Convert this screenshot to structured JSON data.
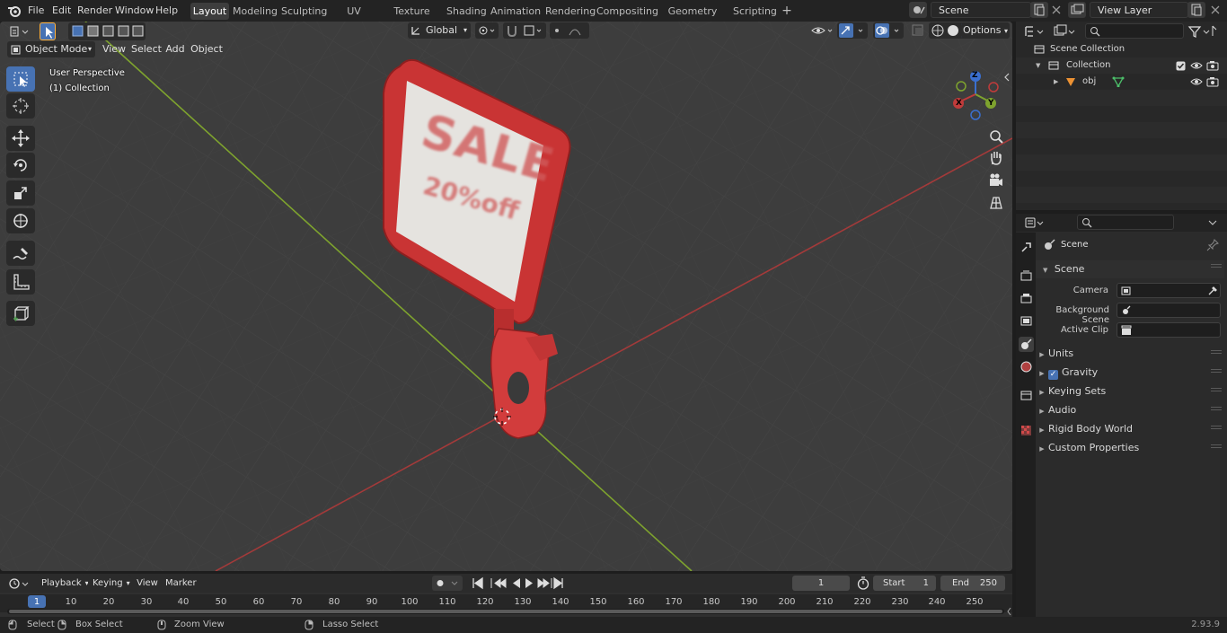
{
  "menubar": {
    "items": [
      "File",
      "Edit",
      "Render",
      "Window",
      "Help"
    ],
    "workspaces": [
      "Layout",
      "Modeling",
      "Sculpting",
      "UV Editing",
      "Texture Paint",
      "Shading",
      "Animation",
      "Rendering",
      "Compositing",
      "Geometry Nodes",
      "Scripting"
    ],
    "add_tab": "+",
    "scene_name": "Scene",
    "view_layer": "View Layer"
  },
  "viewport": {
    "mode": "Object Mode",
    "menus": [
      "View",
      "Select",
      "Add",
      "Object"
    ],
    "transform_orientation": "Global",
    "options_label": "Options",
    "overlay_title": "User Perspective",
    "overlay_collection": "(1) Collection",
    "sign_line1": "SALE",
    "sign_line2": "20%off",
    "gizmo": {
      "z": "Z",
      "y": "Y",
      "x": "X"
    }
  },
  "outliner": {
    "rows": [
      {
        "label": "Scene Collection",
        "indent": 0
      },
      {
        "label": "Collection",
        "indent": 1
      },
      {
        "label": "obj",
        "indent": 2
      }
    ]
  },
  "properties": {
    "header": "Scene",
    "panel_title": "Scene",
    "fields": [
      {
        "label": "Camera"
      },
      {
        "label": "Background Scene"
      },
      {
        "label": "Active Clip"
      }
    ],
    "panels": [
      "Units",
      "Gravity",
      "Keying Sets",
      "Audio",
      "Rigid Body World",
      "Custom Properties"
    ],
    "gravity_checked": true
  },
  "timeline": {
    "menus": [
      "Playback",
      "Keying",
      "View",
      "Marker"
    ],
    "current_frame": "1",
    "start_label": "Start",
    "start_value": "1",
    "end_label": "End",
    "end_value": "250",
    "ruler": [
      "1",
      "10",
      "20",
      "30",
      "40",
      "50",
      "60",
      "70",
      "80",
      "90",
      "100",
      "110",
      "120",
      "130",
      "140",
      "150",
      "160",
      "170",
      "180",
      "190",
      "200",
      "210",
      "220",
      "230",
      "240",
      "250"
    ]
  },
  "statusbar": {
    "items": [
      "Select",
      "Box Select",
      "Zoom View",
      "Lasso Select"
    ],
    "version": "2.93.9"
  },
  "colors": {
    "accent": "#4772b3",
    "x_axis": "#a33a3a",
    "y_axis": "#7ea32e",
    "sign_red": "#d23c3c"
  }
}
